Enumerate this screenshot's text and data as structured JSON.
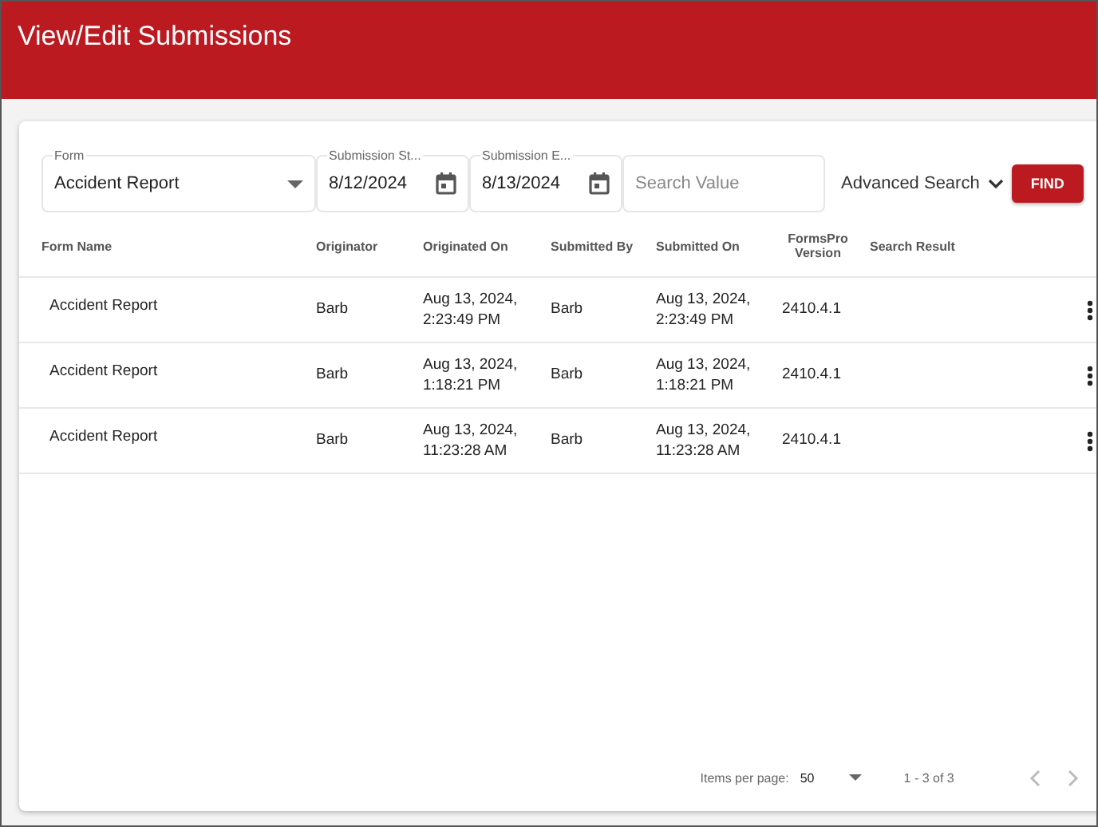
{
  "window": {
    "title": "View/Edit Submissions"
  },
  "filters": {
    "form": {
      "label": "Form",
      "value": "Accident Report"
    },
    "start": {
      "label": "Submission St...",
      "value": "8/12/2024"
    },
    "end": {
      "label": "Submission E...",
      "value": "8/13/2024"
    },
    "search": {
      "placeholder": "Search Value"
    },
    "advanced": "Advanced Search",
    "find": "FIND"
  },
  "table": {
    "columns": [
      "Form Name",
      "Originator",
      "Originated On",
      "Submitted By",
      "Submitted On",
      "FormsPro Version",
      "Search Result"
    ],
    "rows": [
      {
        "form_name": "Accident Report",
        "originator": "Barb",
        "originated_on": "Aug 13, 2024, 2:23:49 PM",
        "submitted_by": "Barb",
        "submitted_on": "Aug 13, 2024, 2:23:49 PM",
        "version": "2410.4.1"
      },
      {
        "form_name": "Accident Report",
        "originator": "Barb",
        "originated_on": "Aug 13, 2024, 1:18:21 PM",
        "submitted_by": "Barb",
        "submitted_on": "Aug 13, 2024, 1:18:21 PM",
        "version": "2410.4.1"
      },
      {
        "form_name": "Accident Report",
        "originator": "Barb",
        "originated_on": "Aug 13, 2024, 11:23:28 AM",
        "submitted_by": "Barb",
        "submitted_on": "Aug 13, 2024, 11:23:28 AM",
        "version": "2410.4.1"
      }
    ]
  },
  "paginator": {
    "items_label": "Items per page:",
    "page_size": "50",
    "range": "1 - 3 of 3"
  }
}
